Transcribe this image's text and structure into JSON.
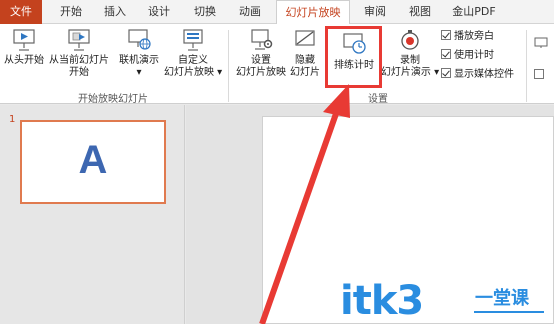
{
  "tabs": [
    {
      "label": "文件"
    },
    {
      "label": "开始"
    },
    {
      "label": "插入"
    },
    {
      "label": "设计"
    },
    {
      "label": "切换"
    },
    {
      "label": "动画"
    },
    {
      "label": "幻灯片放映"
    },
    {
      "label": "审阅"
    },
    {
      "label": "视图"
    },
    {
      "label": "金山PDF"
    }
  ],
  "ribbon": {
    "group_start": {
      "label": "开始放映幻灯片",
      "from_start": "从头开始",
      "from_current_line1": "从当前幻灯片",
      "from_current_line2": "开始",
      "online_line1": "联机演示",
      "online_line2": "▾",
      "custom_line1": "自定义",
      "custom_line2": "幻灯片放映 ▾"
    },
    "group_setup": {
      "label": "设置",
      "setup_line1": "设置",
      "setup_line2": "幻灯片放映",
      "hide_line1": "隐藏",
      "hide_line2": "幻灯片",
      "rehearse": "排练计时",
      "record_line1": "录制",
      "record_line2": "幻灯片演示 ▾",
      "play_narration": "播放旁白",
      "use_timings": "使用计时",
      "show_media_controls": "显示媒体控件"
    }
  },
  "slides": {
    "thumb_number": "1",
    "thumb_letter": "A"
  },
  "watermark": {
    "main": "itk3",
    "sub": "一堂课"
  },
  "colors": {
    "accent": "#c4421e",
    "highlight": "#e83a34",
    "watermark": "#2a8de0"
  }
}
